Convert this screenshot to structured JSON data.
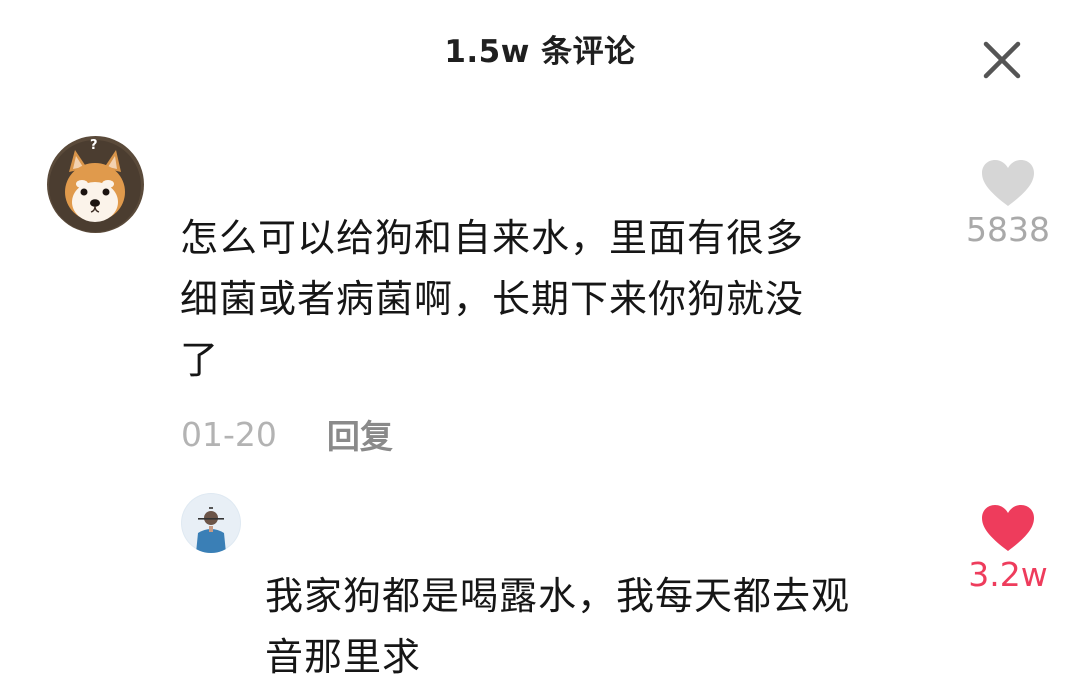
{
  "header": {
    "title": "1.5w 条评论"
  },
  "comments": [
    {
      "text_line1": "怎么可以给狗和自来水，里面有很多",
      "text_line2": "细菌或者病菌啊，长期下来你狗就没",
      "text_line3": "了",
      "date": "01-20",
      "reply_label": "回复",
      "likes": "5838",
      "liked": false,
      "avatar_icon": "shiba-dog-avatar"
    }
  ],
  "replies": [
    {
      "text_line1": "我家狗都是喝露水，我每天都去观",
      "text_line2": "音那里求",
      "likes": "3.2w",
      "liked": true,
      "avatar_icon": "person-avatar"
    }
  ],
  "colors": {
    "like_active": "#ee3c5c",
    "like_inactive": "#d6d6d6",
    "muted_text": "#b3b3b3"
  }
}
